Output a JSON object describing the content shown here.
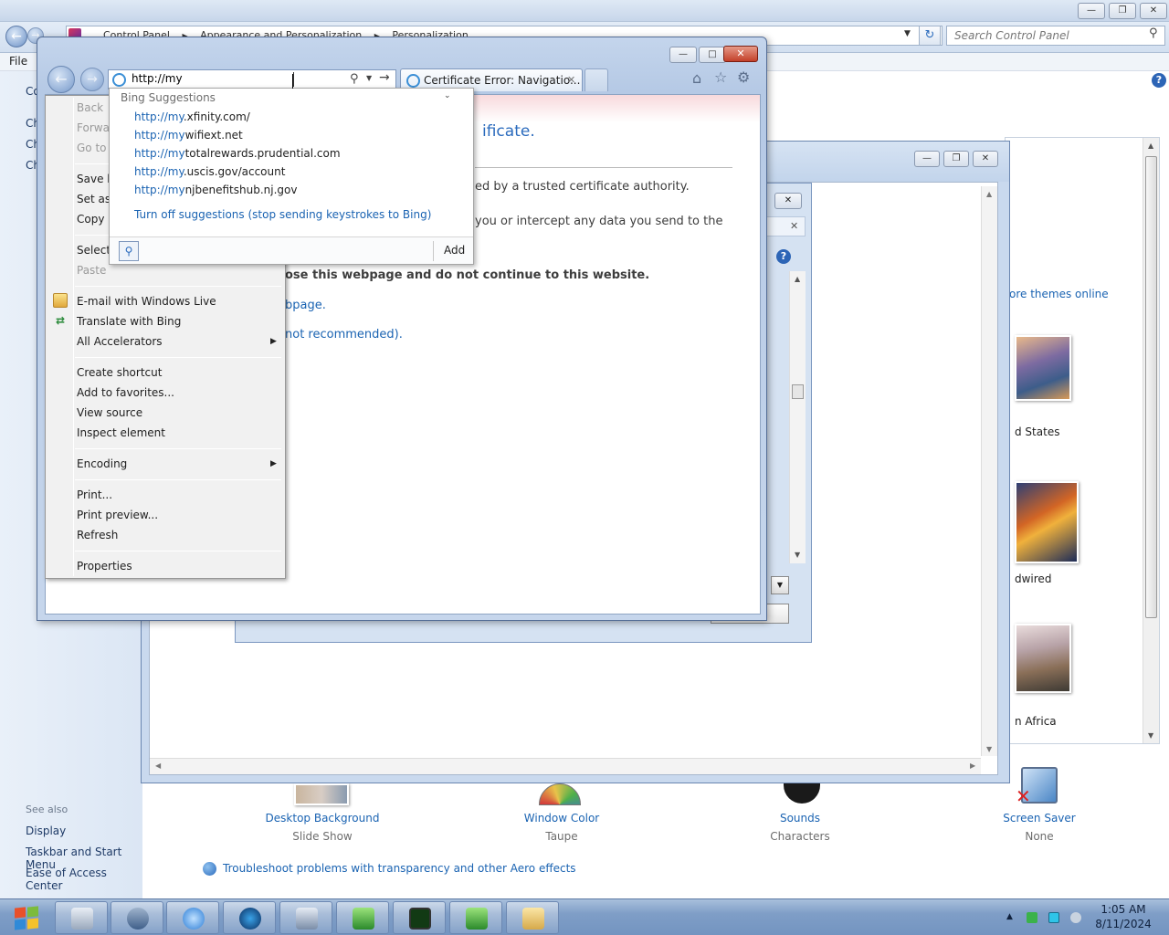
{
  "control_panel": {
    "breadcrumb": [
      "Control Panel",
      "Appearance and Personalization",
      "Personalization"
    ],
    "search_placeholder": "Search Control Panel",
    "menu_file": "File",
    "left_nav": [
      "Co",
      "Ch",
      "Ch",
      "Ch"
    ],
    "see_also": {
      "heading": "See also",
      "links": [
        "Display",
        "Taskbar and Start Menu",
        "Ease of Access Center"
      ]
    },
    "get_more_themes": "ore themes online",
    "themes": [
      {
        "label": "d States"
      },
      {
        "label": "dwired"
      },
      {
        "label": "n Africa"
      }
    ],
    "tiles": [
      {
        "label": "Desktop Background",
        "sub": "Slide Show"
      },
      {
        "label": "Window Color",
        "sub": "Taupe"
      },
      {
        "label": "Sounds",
        "sub": "Characters"
      },
      {
        "label": "Screen Saver",
        "sub": "None"
      }
    ],
    "troubleshoot": "Troubleshoot problems with transparency and other Aero effects"
  },
  "ie": {
    "address_value": "http://my",
    "tab_title": "Certificate Error: Navigatio...",
    "cert_page": {
      "heading_fragment": "ificate.",
      "line1": "ed by a trusted certificate authority.",
      "line2": "you or intercept any data you send to the",
      "recommend": "ose this webpage and do not continue to this website.",
      "link1": "bpage.",
      "link2": "not recommended)."
    },
    "suggestions": {
      "header": "Bing Suggestions",
      "typed": "http://my",
      "items": [
        {
          "rest": ".xfinity.com/"
        },
        {
          "rest": "wifiext.net"
        },
        {
          "rest": "totalrewards.prudential.com"
        },
        {
          "rest": ".uscis.gov/account"
        },
        {
          "rest": "njbenefitshub.nj.gov"
        }
      ],
      "turn_off": "Turn off suggestions (stop sending keystrokes to Bing)",
      "add_label": "Add"
    }
  },
  "context_menu": {
    "items": [
      {
        "label": "Back",
        "disabled": true
      },
      {
        "label": "Forwar",
        "disabled": true
      },
      {
        "label": "Go to c",
        "disabled": true
      },
      {
        "label": "Save b",
        "disabled": false
      },
      {
        "label": "Set as l",
        "disabled": false
      },
      {
        "label": "Copy b",
        "disabled": false
      },
      {
        "label": "Select",
        "disabled": false
      },
      {
        "label": "Paste",
        "disabled": true
      },
      {
        "label": "E-mail with Windows Live",
        "disabled": false
      },
      {
        "label": "Translate with Bing",
        "disabled": false
      },
      {
        "label": "All Accelerators",
        "disabled": false
      },
      {
        "label": "Create shortcut",
        "disabled": false
      },
      {
        "label": "Add to favorites...",
        "disabled": false
      },
      {
        "label": "View source",
        "disabled": false
      },
      {
        "label": "Inspect element",
        "disabled": false
      },
      {
        "label": "Encoding",
        "disabled": false
      },
      {
        "label": "Print...",
        "disabled": false
      },
      {
        "label": "Print preview...",
        "disabled": false
      },
      {
        "label": "Refresh",
        "disabled": false
      },
      {
        "label": "Properties",
        "disabled": false
      }
    ]
  },
  "taskbar": {
    "time": "1:05 AM",
    "date": "8/11/2024",
    "colors": {
      "accent": "#2b6bbd",
      "link": "#1a63b2",
      "close": "#c3402a"
    }
  }
}
